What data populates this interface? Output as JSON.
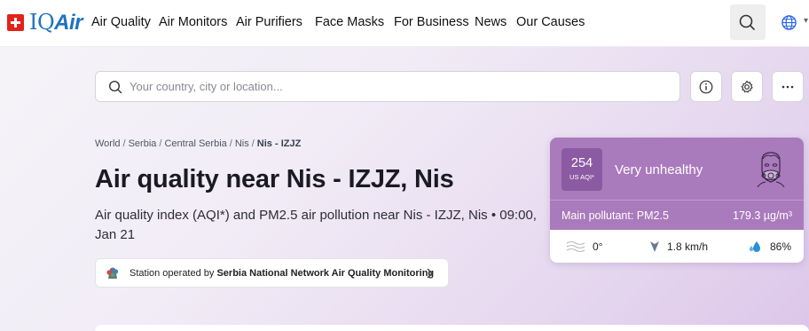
{
  "brand": {
    "prefix": "IQ",
    "suffix": "Air"
  },
  "nav": [
    "Air Quality",
    "Air Monitors",
    "Air Purifiers",
    "Face Masks",
    "For Business",
    "News",
    "Our Causes"
  ],
  "search": {
    "placeholder": "Your country, city or location..."
  },
  "breadcrumb": [
    "World",
    "Serbia",
    "Central Serbia",
    "Nis",
    "Nis - IZJZ"
  ],
  "page": {
    "title": "Air quality near Nis - IZJZ, Nis",
    "subtitle": "Air quality index (AQI*) and PM2.5 air pollution near Nis - IZJZ, Nis • 09:00, Jan 21"
  },
  "station": {
    "prefix": "Station operated by ",
    "operator": "Serbia National Network Air Quality Monitoring"
  },
  "aqi": {
    "value": "254",
    "unit": "US AQI*",
    "level": "Very unhealthy",
    "pollutant": "Main pollutant: PM2.5",
    "concentration": "179.3  µg/m³",
    "temperature": "0°",
    "wind": "1.8 km/h",
    "humidity": "86%",
    "colors": {
      "card": "#a97abc",
      "badge": "#8b5aa3"
    }
  }
}
